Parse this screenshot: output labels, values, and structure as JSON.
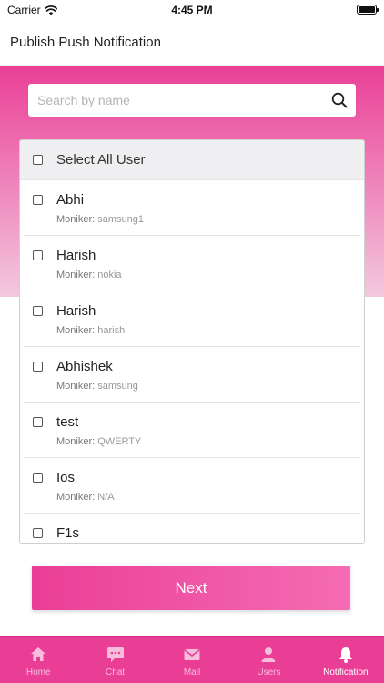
{
  "status_bar": {
    "carrier": "Carrier",
    "time": "4:45 PM"
  },
  "header": {
    "title": "Publish Push Notification"
  },
  "search": {
    "placeholder": "Search by name",
    "value": ""
  },
  "select_all": {
    "label": "Select All User",
    "checked": false
  },
  "moniker_label": "Moniker:",
  "users": [
    {
      "name": "Abhi",
      "moniker": "samsung1"
    },
    {
      "name": "Harish",
      "moniker": "nokia"
    },
    {
      "name": "Harish",
      "moniker": "harish"
    },
    {
      "name": "Abhishek",
      "moniker": "samsung"
    },
    {
      "name": "test",
      "moniker": "QWERTY"
    },
    {
      "name": "Ios",
      "moniker": "N/A"
    },
    {
      "name": "F1s",
      "moniker": ""
    }
  ],
  "next_button": {
    "label": "Next"
  },
  "tabs": [
    {
      "label": "Home",
      "icon": "home-icon",
      "active": false
    },
    {
      "label": "Chat",
      "icon": "chat-icon",
      "active": false
    },
    {
      "label": "Mail",
      "icon": "mail-icon",
      "active": false
    },
    {
      "label": "Users",
      "icon": "users-icon",
      "active": false
    },
    {
      "label": "Notification",
      "icon": "bell-icon",
      "active": true
    }
  ],
  "colors": {
    "accent": "#ea3e96",
    "accent_light": "#f56cb4",
    "band_bottom": "#f3c9df"
  }
}
